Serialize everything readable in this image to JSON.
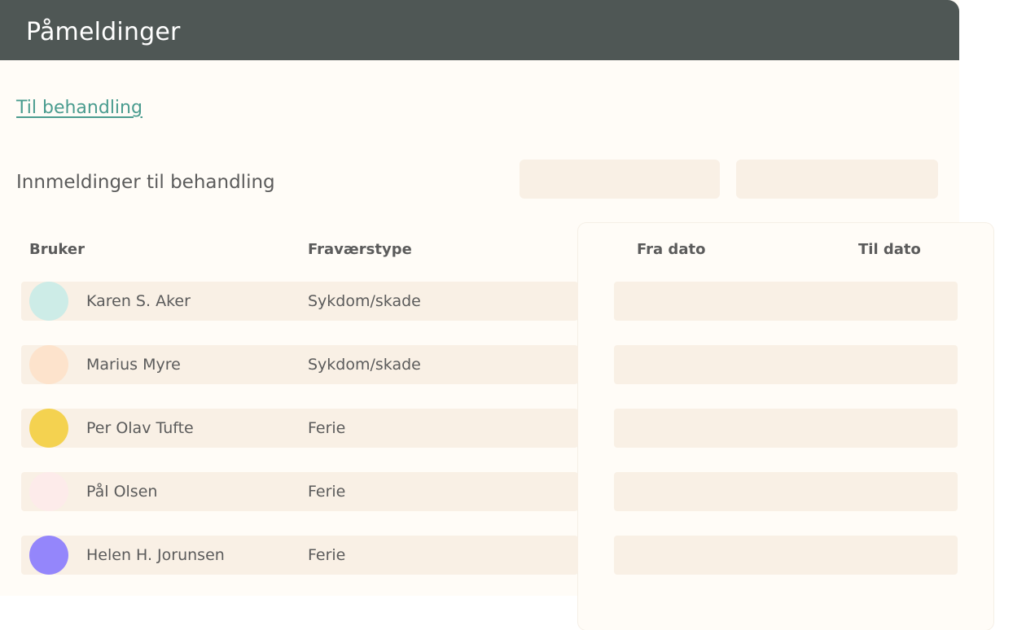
{
  "header": {
    "title": "Påmeldinger"
  },
  "nav": {
    "link_label": "Til behandling"
  },
  "section": {
    "subtitle": "Innmeldinger til behandling"
  },
  "table": {
    "columns": {
      "bruker": "Bruker",
      "type": "Fraværstype",
      "fra": "Fra dato",
      "til": "Til dato"
    },
    "rows": [
      {
        "name": "Karen S. Aker",
        "type": "Sykdom/skade",
        "avatar_color": "#cdece7"
      },
      {
        "name": "Marius Myre",
        "type": "Sykdom/skade",
        "avatar_color": "#fde3cc"
      },
      {
        "name": "Per Olav Tufte",
        "type": "Ferie",
        "avatar_color": "#f4d250"
      },
      {
        "name": "Pål Olsen",
        "type": "Ferie",
        "avatar_color": "#fdebea"
      },
      {
        "name": "Helen H. Jorunsen",
        "type": "Ferie",
        "avatar_color": "#9486fb"
      }
    ]
  },
  "colors": {
    "header_bg": "#4f5755",
    "link": "#4a9c8f",
    "row_bg": "#f9f0e5",
    "page_bg": "#fffcf7"
  }
}
